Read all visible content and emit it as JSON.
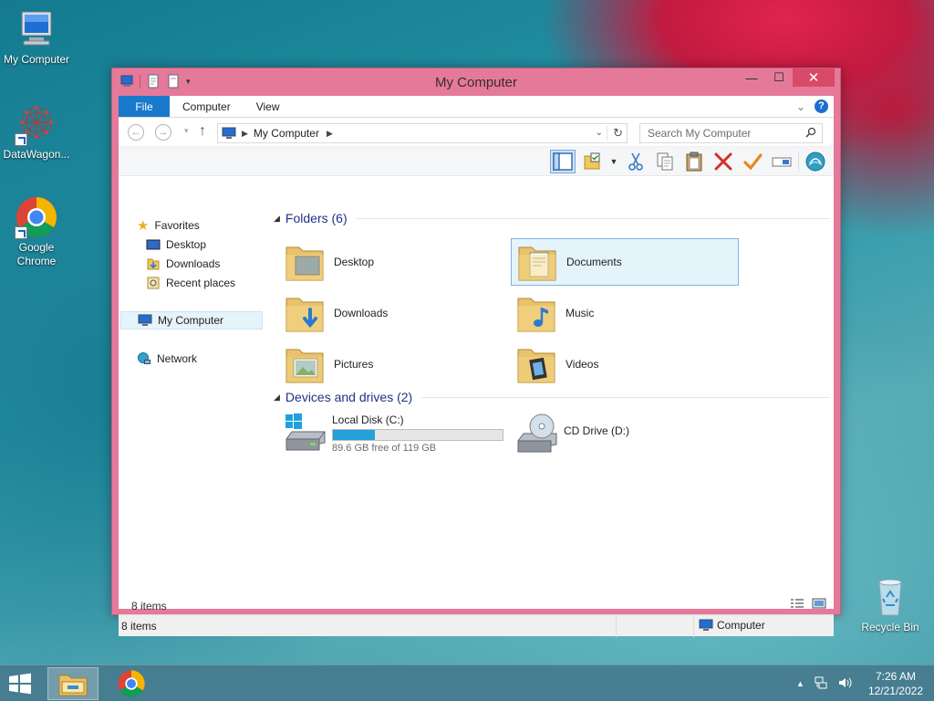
{
  "desktop": {
    "icons": [
      {
        "label": "My Computer",
        "icon": "my-computer-icon"
      },
      {
        "label": "DataWagon...",
        "icon": "datawagon-icon"
      },
      {
        "label": "Google Chrome",
        "icon": "chrome-icon"
      },
      {
        "label": "Recycle Bin",
        "icon": "recycle-bin-icon"
      }
    ]
  },
  "window": {
    "title": "My Computer",
    "caption_buttons": {
      "minimize": "—",
      "maximize": "☐",
      "close": "✕"
    },
    "ribbon_tabs": [
      "File",
      "Computer",
      "View"
    ],
    "help": "?",
    "address": {
      "path": "My Computer",
      "nav_back": "←",
      "nav_forward": "→",
      "nav_up": "↑",
      "refresh": "↻"
    },
    "search": {
      "placeholder": "Search My Computer"
    },
    "toolbar_icons": [
      "preview-pane-icon",
      "properties-icon",
      "cut-icon",
      "copy-icon",
      "paste-icon",
      "delete-icon",
      "apply-icon",
      "rename-icon",
      "shell-icon"
    ],
    "nav_pane": {
      "favorites": "Favorites",
      "favorites_items": [
        "Desktop",
        "Downloads",
        "Recent places"
      ],
      "this_pc": "My Computer",
      "network": "Network"
    },
    "groups": {
      "folders": "Folders (6)",
      "devices": "Devices and drives (2)"
    },
    "folders": [
      {
        "label": "Desktop",
        "icon": "desktop-folder-icon",
        "selected": false
      },
      {
        "label": "Documents",
        "icon": "documents-folder-icon",
        "selected": true
      },
      {
        "label": "Downloads",
        "icon": "downloads-folder-icon",
        "selected": false
      },
      {
        "label": "Music",
        "icon": "music-folder-icon",
        "selected": false
      },
      {
        "label": "Pictures",
        "icon": "pictures-folder-icon",
        "selected": false
      },
      {
        "label": "Videos",
        "icon": "videos-folder-icon",
        "selected": false
      }
    ],
    "drives": [
      {
        "label": "Local Disk (C:)",
        "free_text": "89.6 GB free of 119 GB",
        "used_fraction": 0.247
      },
      {
        "label": "CD Drive (D:)"
      }
    ],
    "item_count": "8 items",
    "status": {
      "left": "8 items",
      "right": "Computer"
    }
  },
  "taskbar": {
    "time": "7:26 AM",
    "date": "12/21/2022",
    "tray_up": "▲"
  },
  "colors": {
    "window_frame": "#e5799a",
    "close_button": "#d94a68",
    "file_tab": "#1979ca",
    "group_header_text": "#1e3287",
    "selection_fill": "#e5f3fb",
    "drive_bar": "#26a0da"
  }
}
